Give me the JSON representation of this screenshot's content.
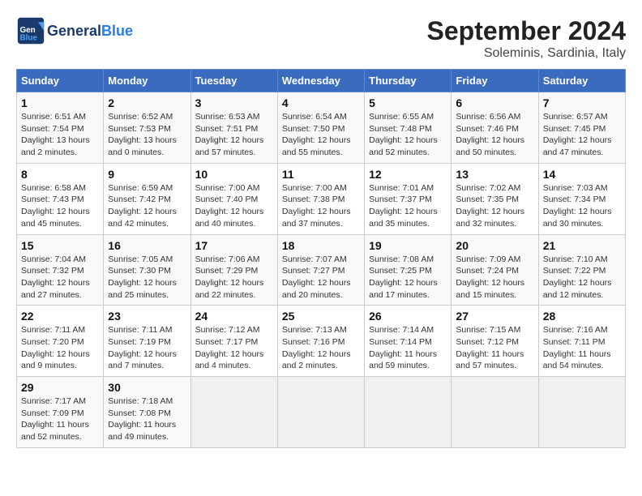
{
  "header": {
    "logo_text_general": "General",
    "logo_text_blue": "Blue",
    "title": "September 2024",
    "subtitle": "Soleminis, Sardinia, Italy"
  },
  "columns": [
    "Sunday",
    "Monday",
    "Tuesday",
    "Wednesday",
    "Thursday",
    "Friday",
    "Saturday"
  ],
  "weeks": [
    {
      "days": [
        {
          "num": "1",
          "info": "Sunrise: 6:51 AM\nSunset: 7:54 PM\nDaylight: 13 hours\nand 2 minutes."
        },
        {
          "num": "2",
          "info": "Sunrise: 6:52 AM\nSunset: 7:53 PM\nDaylight: 13 hours\nand 0 minutes."
        },
        {
          "num": "3",
          "info": "Sunrise: 6:53 AM\nSunset: 7:51 PM\nDaylight: 12 hours\nand 57 minutes."
        },
        {
          "num": "4",
          "info": "Sunrise: 6:54 AM\nSunset: 7:50 PM\nDaylight: 12 hours\nand 55 minutes."
        },
        {
          "num": "5",
          "info": "Sunrise: 6:55 AM\nSunset: 7:48 PM\nDaylight: 12 hours\nand 52 minutes."
        },
        {
          "num": "6",
          "info": "Sunrise: 6:56 AM\nSunset: 7:46 PM\nDaylight: 12 hours\nand 50 minutes."
        },
        {
          "num": "7",
          "info": "Sunrise: 6:57 AM\nSunset: 7:45 PM\nDaylight: 12 hours\nand 47 minutes."
        }
      ]
    },
    {
      "days": [
        {
          "num": "8",
          "info": "Sunrise: 6:58 AM\nSunset: 7:43 PM\nDaylight: 12 hours\nand 45 minutes."
        },
        {
          "num": "9",
          "info": "Sunrise: 6:59 AM\nSunset: 7:42 PM\nDaylight: 12 hours\nand 42 minutes."
        },
        {
          "num": "10",
          "info": "Sunrise: 7:00 AM\nSunset: 7:40 PM\nDaylight: 12 hours\nand 40 minutes."
        },
        {
          "num": "11",
          "info": "Sunrise: 7:00 AM\nSunset: 7:38 PM\nDaylight: 12 hours\nand 37 minutes."
        },
        {
          "num": "12",
          "info": "Sunrise: 7:01 AM\nSunset: 7:37 PM\nDaylight: 12 hours\nand 35 minutes."
        },
        {
          "num": "13",
          "info": "Sunrise: 7:02 AM\nSunset: 7:35 PM\nDaylight: 12 hours\nand 32 minutes."
        },
        {
          "num": "14",
          "info": "Sunrise: 7:03 AM\nSunset: 7:34 PM\nDaylight: 12 hours\nand 30 minutes."
        }
      ]
    },
    {
      "days": [
        {
          "num": "15",
          "info": "Sunrise: 7:04 AM\nSunset: 7:32 PM\nDaylight: 12 hours\nand 27 minutes."
        },
        {
          "num": "16",
          "info": "Sunrise: 7:05 AM\nSunset: 7:30 PM\nDaylight: 12 hours\nand 25 minutes."
        },
        {
          "num": "17",
          "info": "Sunrise: 7:06 AM\nSunset: 7:29 PM\nDaylight: 12 hours\nand 22 minutes."
        },
        {
          "num": "18",
          "info": "Sunrise: 7:07 AM\nSunset: 7:27 PM\nDaylight: 12 hours\nand 20 minutes."
        },
        {
          "num": "19",
          "info": "Sunrise: 7:08 AM\nSunset: 7:25 PM\nDaylight: 12 hours\nand 17 minutes."
        },
        {
          "num": "20",
          "info": "Sunrise: 7:09 AM\nSunset: 7:24 PM\nDaylight: 12 hours\nand 15 minutes."
        },
        {
          "num": "21",
          "info": "Sunrise: 7:10 AM\nSunset: 7:22 PM\nDaylight: 12 hours\nand 12 minutes."
        }
      ]
    },
    {
      "days": [
        {
          "num": "22",
          "info": "Sunrise: 7:11 AM\nSunset: 7:20 PM\nDaylight: 12 hours\nand 9 minutes."
        },
        {
          "num": "23",
          "info": "Sunrise: 7:11 AM\nSunset: 7:19 PM\nDaylight: 12 hours\nand 7 minutes."
        },
        {
          "num": "24",
          "info": "Sunrise: 7:12 AM\nSunset: 7:17 PM\nDaylight: 12 hours\nand 4 minutes."
        },
        {
          "num": "25",
          "info": "Sunrise: 7:13 AM\nSunset: 7:16 PM\nDaylight: 12 hours\nand 2 minutes."
        },
        {
          "num": "26",
          "info": "Sunrise: 7:14 AM\nSunset: 7:14 PM\nDaylight: 11 hours\nand 59 minutes."
        },
        {
          "num": "27",
          "info": "Sunrise: 7:15 AM\nSunset: 7:12 PM\nDaylight: 11 hours\nand 57 minutes."
        },
        {
          "num": "28",
          "info": "Sunrise: 7:16 AM\nSunset: 7:11 PM\nDaylight: 11 hours\nand 54 minutes."
        }
      ]
    },
    {
      "days": [
        {
          "num": "29",
          "info": "Sunrise: 7:17 AM\nSunset: 7:09 PM\nDaylight: 11 hours\nand 52 minutes."
        },
        {
          "num": "30",
          "info": "Sunrise: 7:18 AM\nSunset: 7:08 PM\nDaylight: 11 hours\nand 49 minutes."
        },
        {
          "num": "",
          "info": ""
        },
        {
          "num": "",
          "info": ""
        },
        {
          "num": "",
          "info": ""
        },
        {
          "num": "",
          "info": ""
        },
        {
          "num": "",
          "info": ""
        }
      ]
    }
  ]
}
